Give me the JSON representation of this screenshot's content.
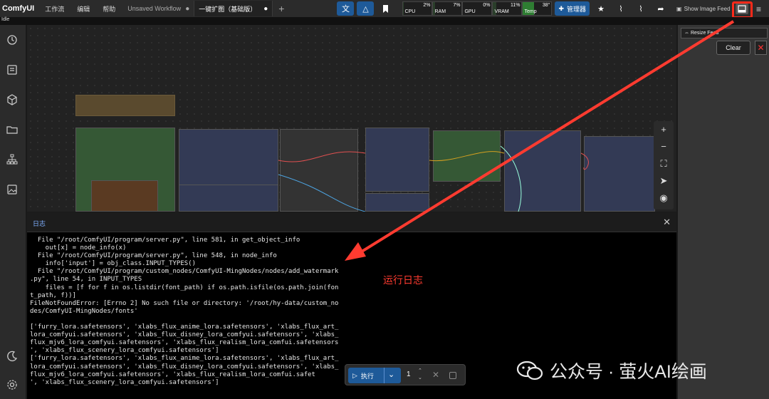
{
  "app": {
    "logo": "ComfyUI",
    "status": "Idle"
  },
  "menu": [
    "工作流",
    "编辑",
    "帮助"
  ],
  "tabs": [
    {
      "label": "Unsaved Workflow",
      "marker": "●"
    },
    {
      "label": "一键扩图（基础版）",
      "marker": "●"
    }
  ],
  "tab_add": "+",
  "toolbar_icons": [
    "translate-icon",
    "mask-icon",
    "bookmark-icon"
  ],
  "meters": [
    {
      "label": "CPU",
      "value": "2%",
      "level": 0.02
    },
    {
      "label": "RAM",
      "value": "7%",
      "level": 0.07
    },
    {
      "label": "GPU",
      "value": "0%",
      "level": 0.0
    },
    {
      "label": "VRAM",
      "value": "11%",
      "level": 0.11
    },
    {
      "label": "Temp",
      "value": "38°",
      "level": 0.38
    }
  ],
  "manager_label": "管理器",
  "feed_label": "Show Image Feed",
  "right_panel": {
    "resize_label": "Resize Feed",
    "clear_label": "Clear",
    "close_label": "✕"
  },
  "log": {
    "title": "日志",
    "lines": [
      "  File \"/root/ComfyUI/program/server.py\", line 581, in get_object_info",
      "    out[x] = node_info(x)",
      "  File \"/root/ComfyUI/program/server.py\", line 548, in node_info",
      "    info['input'] = obj_class.INPUT_TYPES()",
      "  File \"/root/ComfyUI/program/custom_nodes/ComfyUI-MingNodes/nodes/add_watermark",
      ".py\", line 54, in INPUT_TYPES",
      "    files = [f for f in os.listdir(font_path) if os.path.isfile(os.path.join(fon",
      "t_path, f))]",
      "FileNotFoundError: [Errno 2] No such file or directory: '/root/hy-data/custom_no",
      "des/ComfyUI-MingNodes/fonts'",
      "",
      "['furry_lora.safetensors', 'xlabs_flux_anime_lora.safetensors', 'xlabs_flux_art_",
      "lora_comfyui.safetensors', 'xlabs_flux_disney_lora_comfyui.safetensors', 'xlabs_",
      "flux_mjv6_lora_comfyui.safetensors', 'xlabs_flux_realism_lora_comfui.safetensors",
      "', 'xlabs_flux_scenery_lora_comfyui.safetensors']",
      "['furry_lora.safetensors', 'xlabs_flux_anime_lora.safetensors', 'xlabs_flux_art_",
      "lora_comfyui.safetensors', 'xlabs_flux_disney_lora_comfyui.safetensors', 'xlabs_",
      "flux_mjv6_lora_comfyui.safetensors', 'xlabs_flux_realism_lora_comfui.safet",
      "', 'xlabs_flux_scenery_lora_comfyui.safetensors']"
    ]
  },
  "run": {
    "label": "执行",
    "count": "1"
  },
  "annotation": "运行日志",
  "watermark": "公众号 · 萤火AI绘画",
  "colors": {
    "accent": "#1e5a99",
    "annotation_red": "#ff3b30"
  }
}
